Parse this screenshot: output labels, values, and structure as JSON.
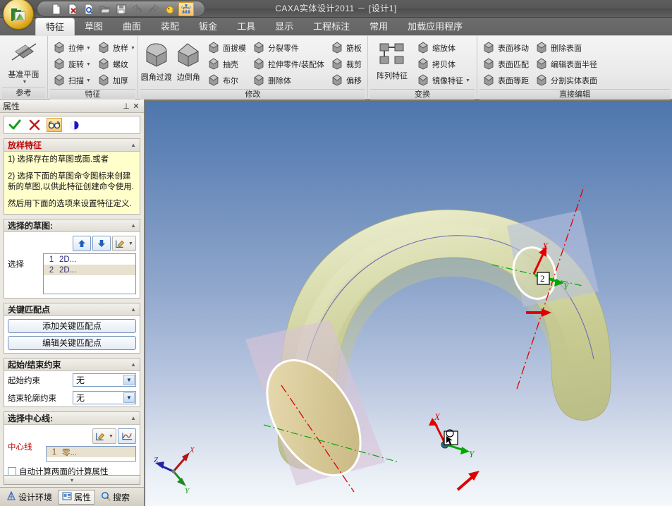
{
  "window": {
    "title": "CAXA实体设计2011 － [设计1]"
  },
  "quick_access": {
    "buttons": [
      {
        "name": "new-icon",
        "label": "新建"
      },
      {
        "name": "new-from-template-icon",
        "label": "根据模板新建"
      },
      {
        "name": "new-preview-icon",
        "label": "新建预览"
      },
      {
        "name": "open-icon",
        "label": "打开"
      },
      {
        "name": "save-icon",
        "label": "保存"
      },
      {
        "name": "undo-icon",
        "label": "撤销"
      },
      {
        "name": "redo-icon",
        "label": "恢复"
      },
      {
        "name": "innovation-icon",
        "label": "创新模式"
      },
      {
        "name": "design-tree-icon",
        "label": "设计树"
      }
    ],
    "overflow_label": "▿"
  },
  "ribbon": {
    "tabs": [
      {
        "label": "特征",
        "selected": true
      },
      {
        "label": "草图",
        "selected": false
      },
      {
        "label": "曲面",
        "selected": false
      },
      {
        "label": "装配",
        "selected": false
      },
      {
        "label": "钣金",
        "selected": false
      },
      {
        "label": "工具",
        "selected": false
      },
      {
        "label": "显示",
        "selected": false
      },
      {
        "label": "工程标注",
        "selected": false
      },
      {
        "label": "常用",
        "selected": false
      },
      {
        "label": "加载应用程序",
        "selected": false
      }
    ],
    "groups": [
      {
        "title": "参考",
        "big": [
          {
            "label": "基准平面",
            "icon": "datum-plane-icon",
            "has_caret": true
          }
        ],
        "columns": []
      },
      {
        "title": "特征",
        "big": [],
        "columns": [
          [
            {
              "label": "拉伸",
              "icon": "extrude-icon",
              "caret": true
            },
            {
              "label": "旋转",
              "icon": "revolve-icon",
              "caret": true
            },
            {
              "label": "扫描",
              "icon": "sweep-icon",
              "caret": true
            }
          ],
          [
            {
              "label": "放样",
              "icon": "loft-icon",
              "caret": true
            },
            {
              "label": "螺纹",
              "icon": "thread-icon",
              "caret": false
            },
            {
              "label": "加厚",
              "icon": "thicken-icon",
              "caret": false
            }
          ]
        ]
      },
      {
        "title": "修改",
        "big": [
          {
            "label": "圆角过渡",
            "icon": "fillet-icon",
            "has_caret": false
          },
          {
            "label": "边倒角",
            "icon": "chamfer-icon",
            "has_caret": false
          }
        ],
        "columns": [
          [
            {
              "label": "面拔模",
              "icon": "face-draft-icon",
              "caret": false
            },
            {
              "label": "抽壳",
              "icon": "shell-icon",
              "caret": false
            },
            {
              "label": "布尔",
              "icon": "boolean-icon",
              "caret": false
            }
          ],
          [
            {
              "label": "分裂零件",
              "icon": "split-part-icon",
              "caret": false
            },
            {
              "label": "拉伸零件/装配体",
              "icon": "stretch-part-icon",
              "caret": false
            },
            {
              "label": "删除体",
              "icon": "delete-body-icon",
              "caret": false
            }
          ],
          [
            {
              "label": "筋板",
              "icon": "rib-icon",
              "caret": false
            },
            {
              "label": "裁剪",
              "icon": "trim-icon",
              "caret": false
            },
            {
              "label": "偏移",
              "icon": "offset-icon",
              "caret": false
            }
          ]
        ]
      },
      {
        "title": "变换",
        "big": [
          {
            "label": "阵列特征",
            "icon": "pattern-feature-icon",
            "has_caret": false
          }
        ],
        "columns": [
          [
            {
              "label": "缩放体",
              "icon": "scale-body-icon",
              "caret": false
            },
            {
              "label": "拷贝体",
              "icon": "copy-body-icon",
              "caret": false
            },
            {
              "label": "镜像特征",
              "icon": "mirror-feature-icon",
              "caret": true
            }
          ]
        ]
      },
      {
        "title": "直接编辑",
        "big": [],
        "columns": [
          [
            {
              "label": "表面移动",
              "icon": "face-move-icon",
              "caret": false
            },
            {
              "label": "表面匹配",
              "icon": "face-match-icon",
              "caret": false
            },
            {
              "label": "表面等距",
              "icon": "face-offset-icon",
              "caret": false
            }
          ],
          [
            {
              "label": "删除表面",
              "icon": "delete-face-icon",
              "caret": false
            },
            {
              "label": "编辑表面半径",
              "icon": "edit-face-radius-icon",
              "caret": false
            },
            {
              "label": "分割实体表面",
              "icon": "split-face-icon",
              "caret": false
            }
          ]
        ]
      }
    ]
  },
  "properties_panel": {
    "header": {
      "title": "属性",
      "pin_label": "⊥",
      "close_label": "✕"
    },
    "command_bar": {
      "accept_label": "✓",
      "cancel_label": "✕",
      "preview_name": "glasses-icon",
      "color_name": "color-swatch-icon"
    },
    "help_section": {
      "title": "放样特征",
      "collapse": "▲",
      "paragraphs": [
        "1) 选择存在的草图或面.或者",
        "2) 选择下面的草图命令图标来创建新的草图,以供此特征创建命令使用.",
        "然后用下面的选项来设置特征定义."
      ]
    },
    "sketch_section": {
      "title": "选择的草图:",
      "collapse": "▲",
      "label": "选择",
      "tools": [
        {
          "name": "move-up-button",
          "glyph": "⬆"
        },
        {
          "name": "move-down-button",
          "glyph": "⬇"
        },
        {
          "name": "edit-sketch-button",
          "glyph": "✎"
        }
      ],
      "items": [
        {
          "index": "1",
          "text": "2D...",
          "selected": false
        },
        {
          "index": "2",
          "text": "2D...",
          "selected": true
        }
      ]
    },
    "match_section": {
      "title": "关键匹配点",
      "collapse": "▲",
      "add_button": "添加关键匹配点",
      "edit_button": "编辑关键匹配点"
    },
    "constraint_section": {
      "title": "起始/结束约束",
      "collapse": "▲",
      "fields": [
        {
          "label": "起始约束",
          "value": "无"
        },
        {
          "label": "结束轮廓约束",
          "value": "无"
        }
      ]
    },
    "centerline_section": {
      "title": "选择中心线:",
      "collapse": "▲",
      "label": "中心线",
      "tools": [
        {
          "name": "edit-centerline-button",
          "glyph": "✎"
        },
        {
          "name": "pick-curve-button",
          "glyph": "∿"
        }
      ],
      "items": [
        {
          "index": "1",
          "text": "零...",
          "selected": true
        }
      ],
      "checkbox_label": "自动计算两面的计算属性"
    },
    "scroll_hint": "▾"
  },
  "bottom_tabs": [
    {
      "label": "设计环境",
      "icon": "design-env-icon",
      "active": false
    },
    {
      "label": "属性",
      "icon": "properties-icon",
      "active": true
    },
    {
      "label": "搜索",
      "icon": "search-icon",
      "active": false
    }
  ],
  "viewport": {
    "labels": {
      "profile_2_marker": "2",
      "axis_x": "X",
      "axis_y": "Y",
      "axis_z": "Z"
    },
    "triad": {
      "x": "X",
      "y": "Y",
      "z": "Z"
    },
    "colors": {
      "solid_fill": "#cfd19a",
      "solid_cap": "#d6cb9a",
      "background_top": "#4e76ad",
      "background_bottom": "#f4f8fb",
      "axis_x": "#e00000",
      "axis_y": "#00a800",
      "axis_z": "#2020d0",
      "centerline": "#5858a8",
      "highlight_outline": "#ffffff",
      "plane_tint": "#c8b8cc"
    }
  }
}
